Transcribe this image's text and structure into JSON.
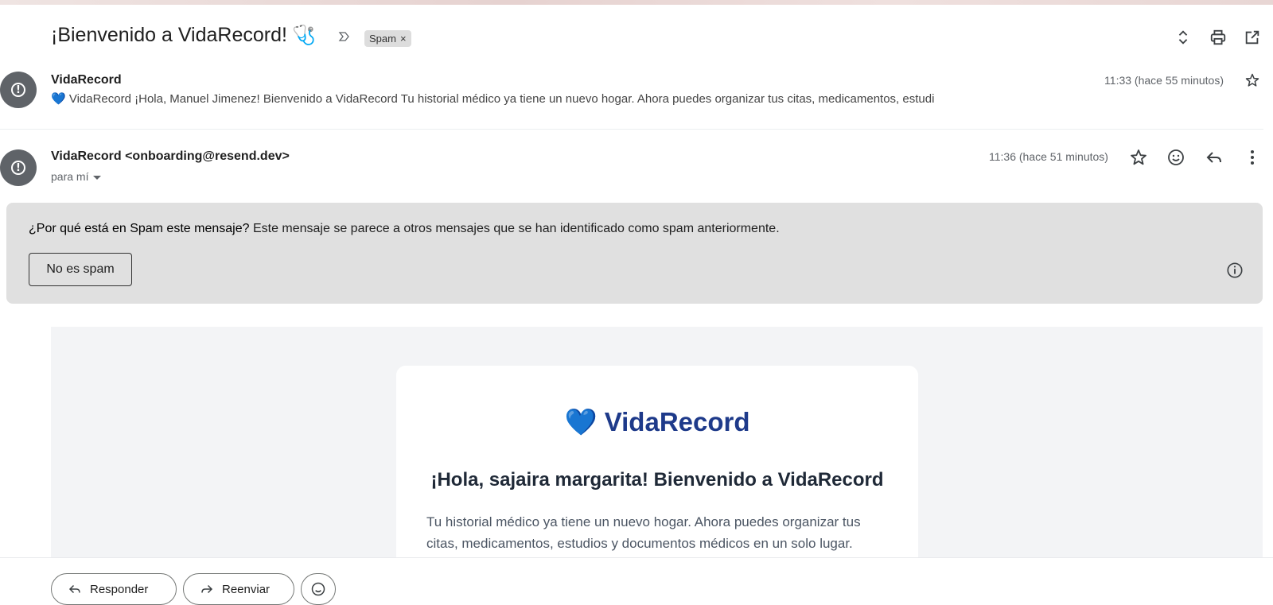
{
  "thread": {
    "subject": "¡Bienvenido a VidaRecord!",
    "subject_emoji": "🩺",
    "label_chip": "Spam",
    "label_remove": "×"
  },
  "icons": {
    "importance": "importance-marker-icon",
    "expand_collapse": "expand-collapse-icon",
    "print": "print-icon",
    "open_new_window": "open-in-new-window-icon"
  },
  "message1": {
    "sender": "VidaRecord",
    "snippet": "💙 VidaRecord ¡Hola, Manuel Jimenez! Bienvenido a VidaRecord Tu historial médico ya tiene un nuevo hogar. Ahora puedes organizar tus citas, medicamentos, estudi",
    "time": "11:33 (hace 55 minutos)"
  },
  "message2": {
    "sender": "VidaRecord <onboarding@resend.dev>",
    "to": "para mí",
    "time": "11:36 (hace 51 minutos)"
  },
  "spam_notice": {
    "question": "¿Por qué está en Spam este mensaje?",
    "explanation": " Este mensaje se parece a otros mensajes que se han identificado como spam anteriormente.",
    "button": "No es spam"
  },
  "email_body": {
    "brand": "💙 VidaRecord",
    "greeting": "¡Hola, sajaira margarita! Bienvenido a VidaRecord",
    "paragraph": "Tu historial médico ya tiene un nuevo hogar. Ahora puedes organizar tus citas, medicamentos, estudios y documentos médicos en un solo lugar."
  },
  "actions": {
    "reply": "Responder",
    "forward": "Reenviar"
  },
  "colors": {
    "avatar": "#5f6368",
    "spam_box": "#e0e0e0",
    "brand_text": "#1e3a8a",
    "email_bg": "#f3f4f6"
  }
}
